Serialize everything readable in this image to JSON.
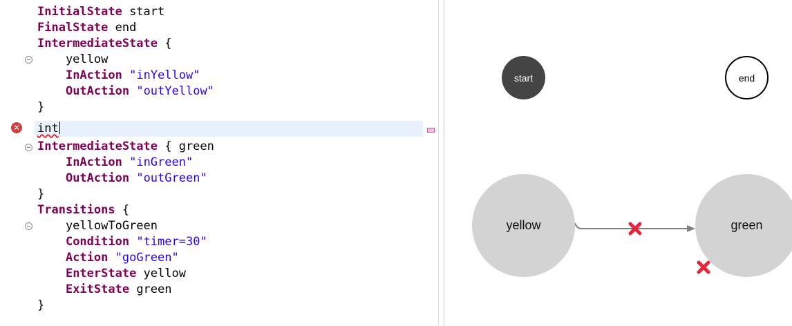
{
  "editor": {
    "lines": [
      {
        "kw": "InitialState",
        "rest": " start"
      },
      {
        "kw": "FinalState",
        "rest": " end"
      },
      {
        "kw": "IntermediateState",
        "rest": " {"
      },
      {
        "text": "    yellow"
      },
      {
        "indent": "    ",
        "kw": "InAction",
        "str": "\"inYellow\""
      },
      {
        "indent": "    ",
        "kw": "OutAction",
        "str": "\"outYellow\""
      },
      {
        "text": "}"
      },
      {
        "error_text": "int"
      },
      {
        "kw": "IntermediateState",
        "rest": " { green"
      },
      {
        "indent": "    ",
        "kw": "InAction",
        "str": "\"inGreen\""
      },
      {
        "indent": "    ",
        "kw": "OutAction",
        "str": "\"outGreen\""
      },
      {
        "text": "}"
      },
      {
        "kw": "Transitions",
        "rest": " {"
      },
      {
        "text": "    yellowToGreen"
      },
      {
        "indent": "    ",
        "kw": "Condition",
        "str": "\"timer=30\""
      },
      {
        "indent": "    ",
        "kw": "Action",
        "str": "\"goGreen\""
      },
      {
        "indent": "    ",
        "kw": "EnterState",
        "rest": " yellow"
      },
      {
        "indent": "    ",
        "kw": "ExitState",
        "rest": " green"
      },
      {
        "text": "}"
      }
    ],
    "colors": {
      "keyword": "#7f0055",
      "string": "#2a00ff",
      "current_line": "#e8f2fe",
      "error": "#d13d3d"
    },
    "error_icon": "error-x-icon"
  },
  "diagram": {
    "states": {
      "start": "start",
      "end": "end",
      "yellow": "yellow",
      "green": "green"
    },
    "transition": {
      "from": "yellow",
      "to": "green",
      "has_error": true
    },
    "colors": {
      "state_fill": "#d3d3d3",
      "initial_fill": "#444444",
      "edge": "#808080",
      "error_mark": "#e8253a"
    }
  }
}
